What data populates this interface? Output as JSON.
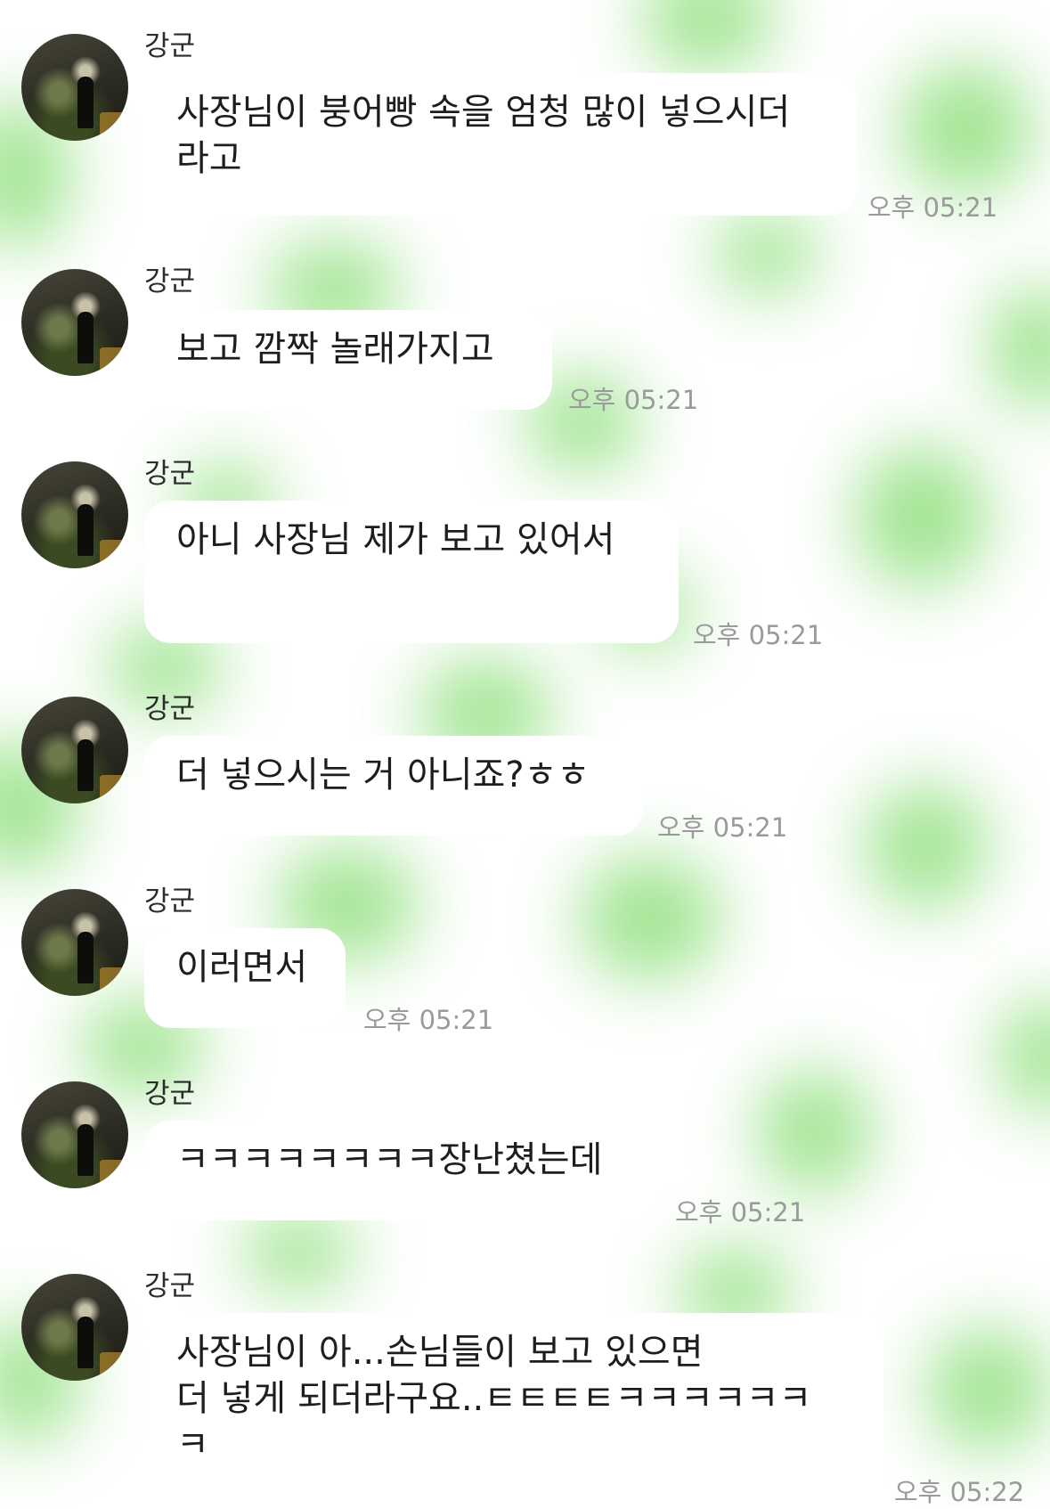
{
  "messages": [
    {
      "sender": "강군",
      "lines": [
        "사장님이 붕어빵 속을 엄청 많이 넣으시더",
        "라고"
      ],
      "time": "오후 05:21"
    },
    {
      "sender": "강군",
      "lines": [
        "보고 깜짝 놀래가지고"
      ],
      "time": "오후 05:21"
    },
    {
      "sender": "강군",
      "lines": [
        "아니 사장님 제가 보고 있어서"
      ],
      "time": "오후 05:21"
    },
    {
      "sender": "강군",
      "lines": [
        "더 넣으시는 거 아니죠?ㅎㅎ"
      ],
      "time": "오후 05:21"
    },
    {
      "sender": "강군",
      "lines": [
        "이러면서"
      ],
      "time": "오후 05:21"
    },
    {
      "sender": "강군",
      "lines": [
        "ㅋㅋㅋㅋㅋㅋㅋㅋ장난쳤는데"
      ],
      "time": "오후 05:21"
    },
    {
      "sender": "강군",
      "lines": [
        "사장님이 아...손님들이 보고 있으면",
        "더 넣게 되더라구요..ㅌㅌㅌㅌㅋㅋㅋㅋㅋㅋ",
        "ㅋ"
      ],
      "time": "오후 05:22"
    }
  ],
  "colors": {
    "bubble": "#ffffff",
    "background_accent": "#8fe07d",
    "timestamp": "#9a9a9a"
  }
}
